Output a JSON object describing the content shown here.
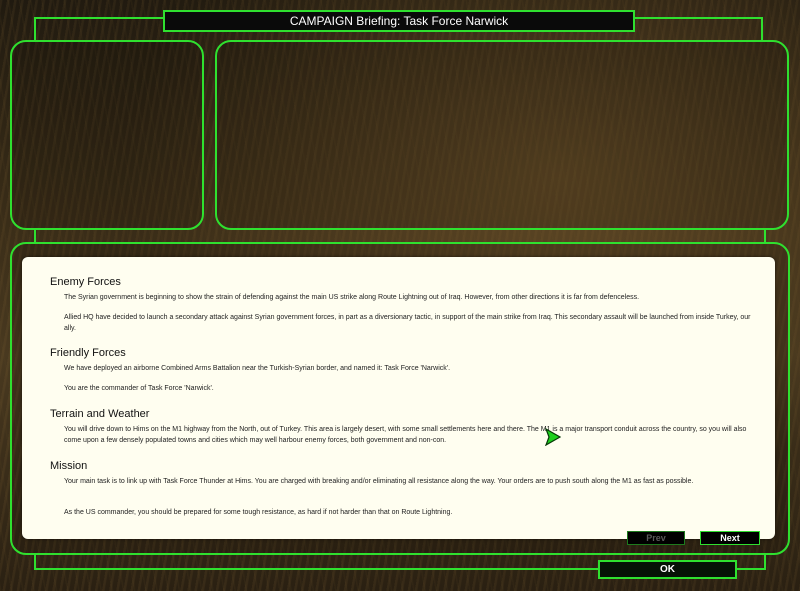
{
  "header": {
    "title": "CAMPAIGN Briefing:  Task Force Narwick"
  },
  "briefing": {
    "sections": [
      {
        "heading": "Enemy Forces",
        "paragraphs": [
          "The Syrian government is beginning to show the strain of defending against the main US strike along Route Lightning out of Iraq. However, from other directions it is far from defenceless.",
          "Allied HQ have decided to launch a secondary attack against Syrian government forces, in part as a diversionary tactic, in support of the main strike from Iraq. This secondary assault will be launched from inside Turkey, our ally."
        ]
      },
      {
        "heading": "Friendly Forces",
        "paragraphs": [
          "We have deployed an airborne Combined Arms Battalion near the Turkish-Syrian border, and named it: Task Force 'Narwick'.",
          "You are the commander of Task Force 'Narwick'."
        ]
      },
      {
        "heading": "Terrain and Weather",
        "paragraphs": [
          "You will drive down to Hims on the M1 highway from the North, out of Turkey. This area is largely desert, with some small settlements here and there. The M1 is a major transport conduit across the country, so you will also come upon a few densely populated towns and cities which may well harbour enemy forces, both government and non-con."
        ]
      },
      {
        "heading": "Mission",
        "paragraphs": [
          "Your main task is to link up with Task Force Thunder at Hims. You are charged with breaking and/or eliminating all resistance along the way. Your orders are to push south along the M1 as fast as possible.",
          "As the US commander, you should be prepared for some tough resistance, as hard if not harder than that on Route Lightning."
        ]
      }
    ]
  },
  "buttons": {
    "prev": "Prev",
    "next": "Next",
    "ok": "OK"
  },
  "colors": {
    "accent": "#2fe02f",
    "panel_bg": "#fffef0"
  },
  "icons": {
    "cursor": "arrow-cursor-icon"
  }
}
